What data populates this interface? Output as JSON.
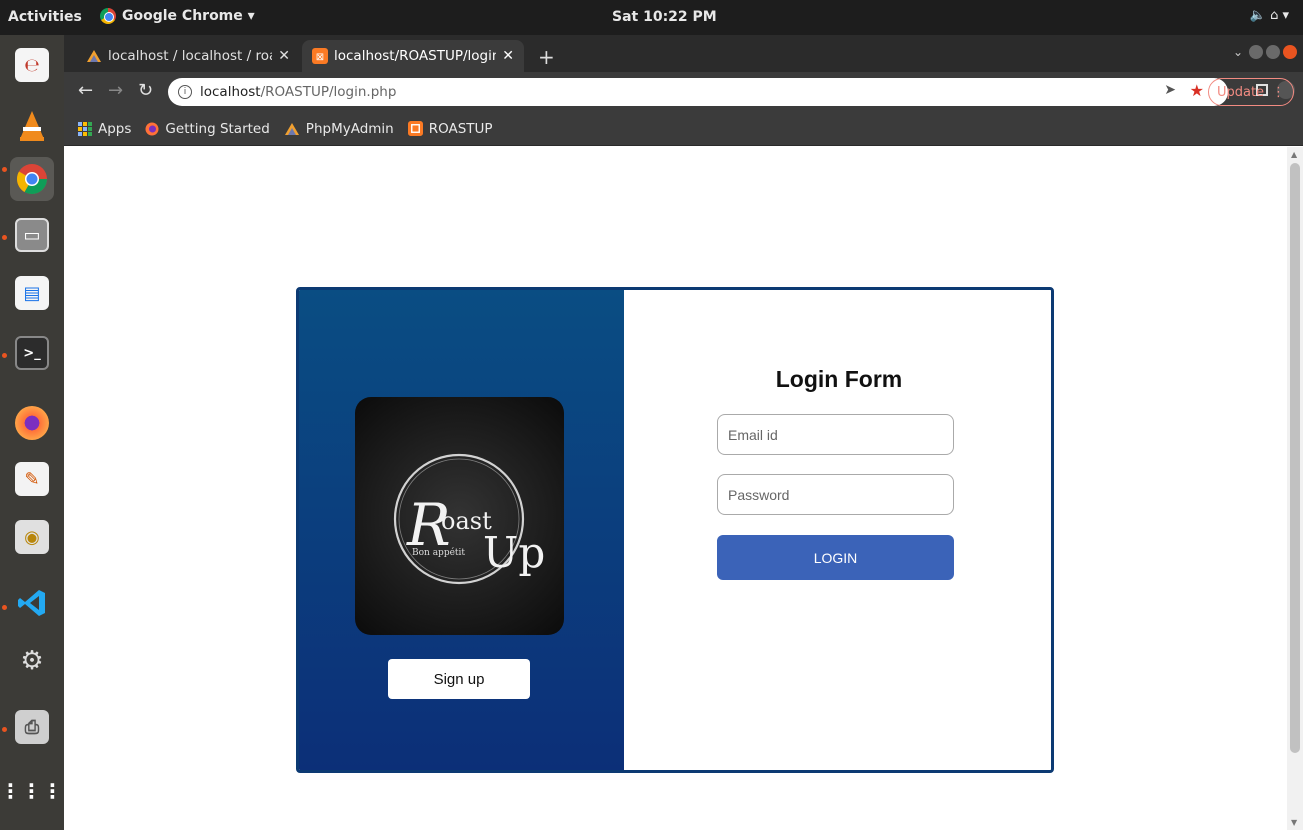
{
  "system": {
    "activities": "Activities",
    "app_name": "Google Chrome ▾",
    "clock": "Sat 10:22 PM",
    "status_icons": "🔈 ⌂ ▾"
  },
  "browser": {
    "tabs": [
      {
        "title": "localhost / localhost / roa",
        "favicon": "phpmyadmin-icon",
        "active": false
      },
      {
        "title": "localhost/ROASTUP/login",
        "favicon": "xampp-icon",
        "active": true
      }
    ],
    "url_host": "localhost",
    "url_path": "/ROASTUP/login.php",
    "update_label": "Update",
    "bookmarks": [
      {
        "label": "Apps",
        "icon": "apps-grid-icon"
      },
      {
        "label": "Getting Started",
        "icon": "firefox-icon"
      },
      {
        "label": "PhpMyAdmin",
        "icon": "phpmyadmin-icon"
      },
      {
        "label": "ROASTUP",
        "icon": "xampp-icon"
      }
    ]
  },
  "page": {
    "form_title": "Login Form",
    "email_placeholder": "Email id",
    "password_placeholder": "Password",
    "login_label": "LOGIN",
    "signup_label": "Sign up",
    "logo": {
      "word1": "Roast",
      "word2": "Up",
      "tagline": "Bon appétit"
    }
  },
  "colors": {
    "panel_top": "#0a4d83",
    "panel_bottom": "#0c2f78",
    "login_button": "#3b63b8"
  }
}
